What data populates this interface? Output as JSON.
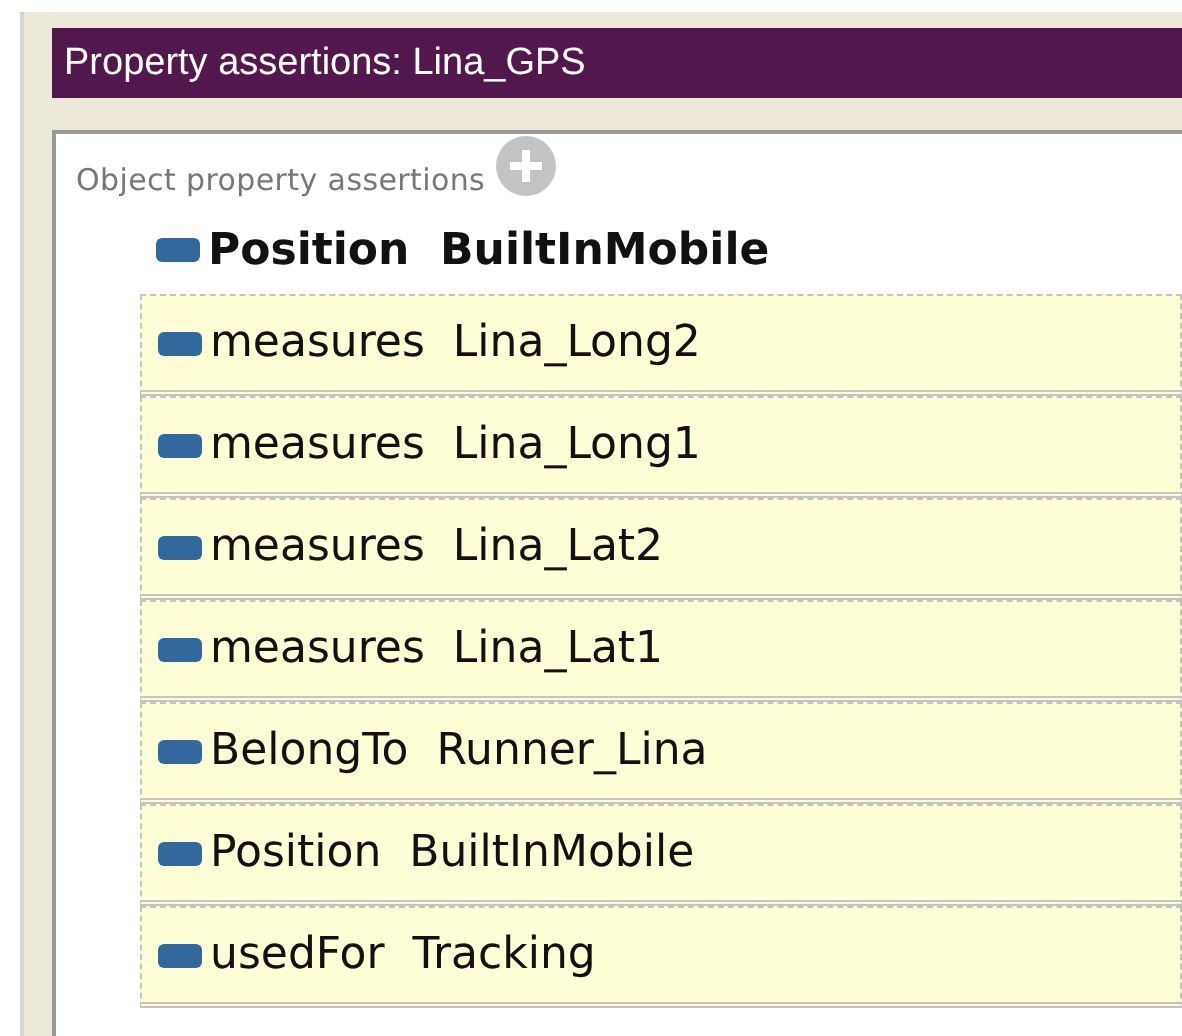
{
  "window": {
    "title": "Property assertions: Lina_GPS"
  },
  "section": {
    "label": "Object property assertions"
  },
  "assertions": [
    {
      "kind": "inferred",
      "property": "Position",
      "value": "BuiltInMobile"
    },
    {
      "kind": "asserted",
      "property": "measures",
      "value": "Lina_Long2"
    },
    {
      "kind": "asserted",
      "property": "measures",
      "value": "Lina_Long1"
    },
    {
      "kind": "asserted",
      "property": "measures",
      "value": "Lina_Lat2"
    },
    {
      "kind": "asserted",
      "property": "measures",
      "value": "Lina_Lat1"
    },
    {
      "kind": "asserted",
      "property": "BelongTo",
      "value": "Runner_Lina"
    },
    {
      "kind": "asserted",
      "property": "Position",
      "value": "BuiltInMobile"
    },
    {
      "kind": "asserted",
      "property": "usedFor",
      "value": "Tracking"
    }
  ]
}
